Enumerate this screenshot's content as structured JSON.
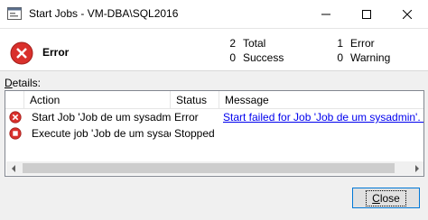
{
  "window": {
    "title": "Start Jobs - VM-DBA\\SQL2016"
  },
  "summary": {
    "status_label": "Error",
    "total_count": "2",
    "total_label": "Total",
    "success_count": "0",
    "success_label": "Success",
    "error_count": "1",
    "error_label": "Error",
    "warning_count": "0",
    "warning_label": "Warning"
  },
  "details": {
    "label_prefix": "D",
    "label_rest": "etails:"
  },
  "grid": {
    "columns": [
      "Action",
      "Status",
      "Message"
    ],
    "rows": [
      {
        "icon": "error-icon",
        "action": "Start Job 'Job de um sysadmin'",
        "status": "Error",
        "message": "Start failed for Job 'Job de um sysadmin'. (Microsoft.SqlServer.Smo)"
      },
      {
        "icon": "stopped-icon",
        "action": "Execute job 'Job de um sysadmin'",
        "status": "Stopped",
        "message": ""
      }
    ]
  },
  "buttons": {
    "close_prefix": "C",
    "close_rest": "lose"
  },
  "colors": {
    "error_red": "#d9302c",
    "link_blue": "#0000ee",
    "focus_blue": "#0078d7"
  }
}
